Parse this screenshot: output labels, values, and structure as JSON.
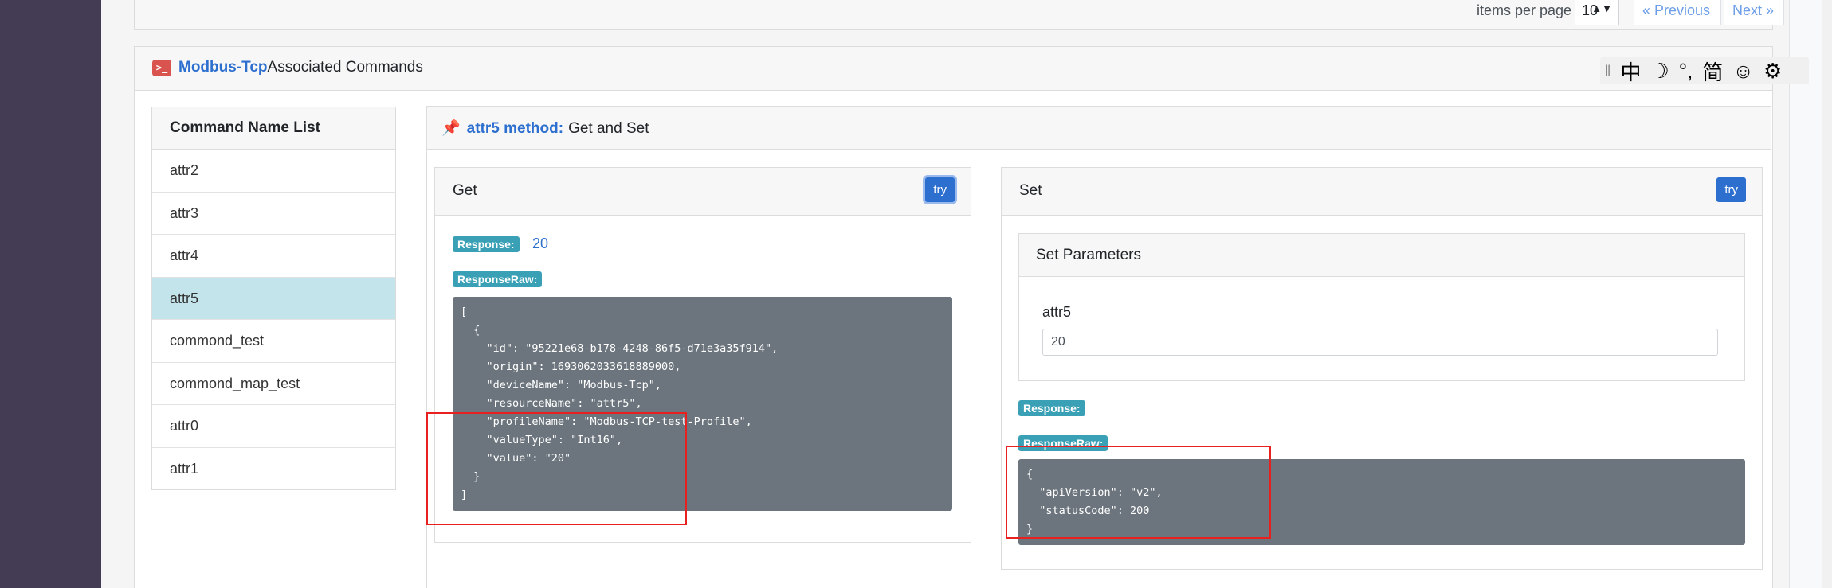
{
  "pagination": {
    "items_per_page_label": "items per page",
    "per_page_value": "10",
    "previous_label": "« Previous",
    "next_label": "Next »"
  },
  "main": {
    "device_name": "Modbus-Tcp",
    "title_suffix": "Associated Commands"
  },
  "toolbar": {
    "grip": "‖",
    "chinese": "中",
    "moon": "☽",
    "punct": "°,",
    "simplified": "简",
    "smile": "☺",
    "gear": "⚙"
  },
  "command_list": {
    "header": "Command Name List",
    "items": [
      "attr2",
      "attr3",
      "attr4",
      "attr5",
      "commond_test",
      "commond_map_test",
      "attr0",
      "attr1"
    ],
    "active_index": 3
  },
  "method": {
    "name": "attr5 method:",
    "type": "Get and Set"
  },
  "get_panel": {
    "title": "Get",
    "try_label": "try",
    "response_label": "Response:",
    "response_value": "20",
    "response_raw_label": "ResponseRaw:",
    "response_raw": "[\n  {\n    \"id\": \"95221e68-b178-4248-86f5-d71e3a35f914\",\n    \"origin\": 1693062033618889000,\n    \"deviceName\": \"Modbus-Tcp\",\n    \"resourceName\": \"attr5\",\n    \"profileName\": \"Modbus-TCP-test-Profile\",\n    \"valueType\": \"Int16\",\n    \"value\": \"20\"\n  }\n]"
  },
  "set_panel": {
    "title": "Set",
    "try_label": "try",
    "params_title": "Set Parameters",
    "param_label": "attr5",
    "param_value": "20",
    "response_label": "Response:",
    "response_raw_label": "ResponseRaw:",
    "response_raw": "{\n  \"apiVersion\": \"v2\",\n  \"statusCode\": 200\n}"
  }
}
